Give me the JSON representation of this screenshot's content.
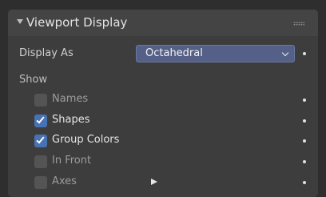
{
  "panel": {
    "title": "Viewport Display",
    "collapse_icon": "triangle-down-icon",
    "drag_icon": "drag-handle-icon"
  },
  "display_as": {
    "label": "Display As",
    "value": "Octahedral",
    "chevron_icon": "chevron-down-icon"
  },
  "show": {
    "label": "Show",
    "items": [
      {
        "label": "Names",
        "checked": false
      },
      {
        "label": "Shapes",
        "checked": true
      },
      {
        "label": "Group Colors",
        "checked": true
      },
      {
        "label": "In Front",
        "checked": false
      },
      {
        "label": "Axes",
        "checked": false
      }
    ]
  },
  "colors": {
    "panel_bg": "#3d3d3d",
    "header_bg": "#444444",
    "dropdown_bg": "#546087",
    "checkbox_checked": "#4772b3",
    "checkbox_unchecked": "#545454"
  }
}
